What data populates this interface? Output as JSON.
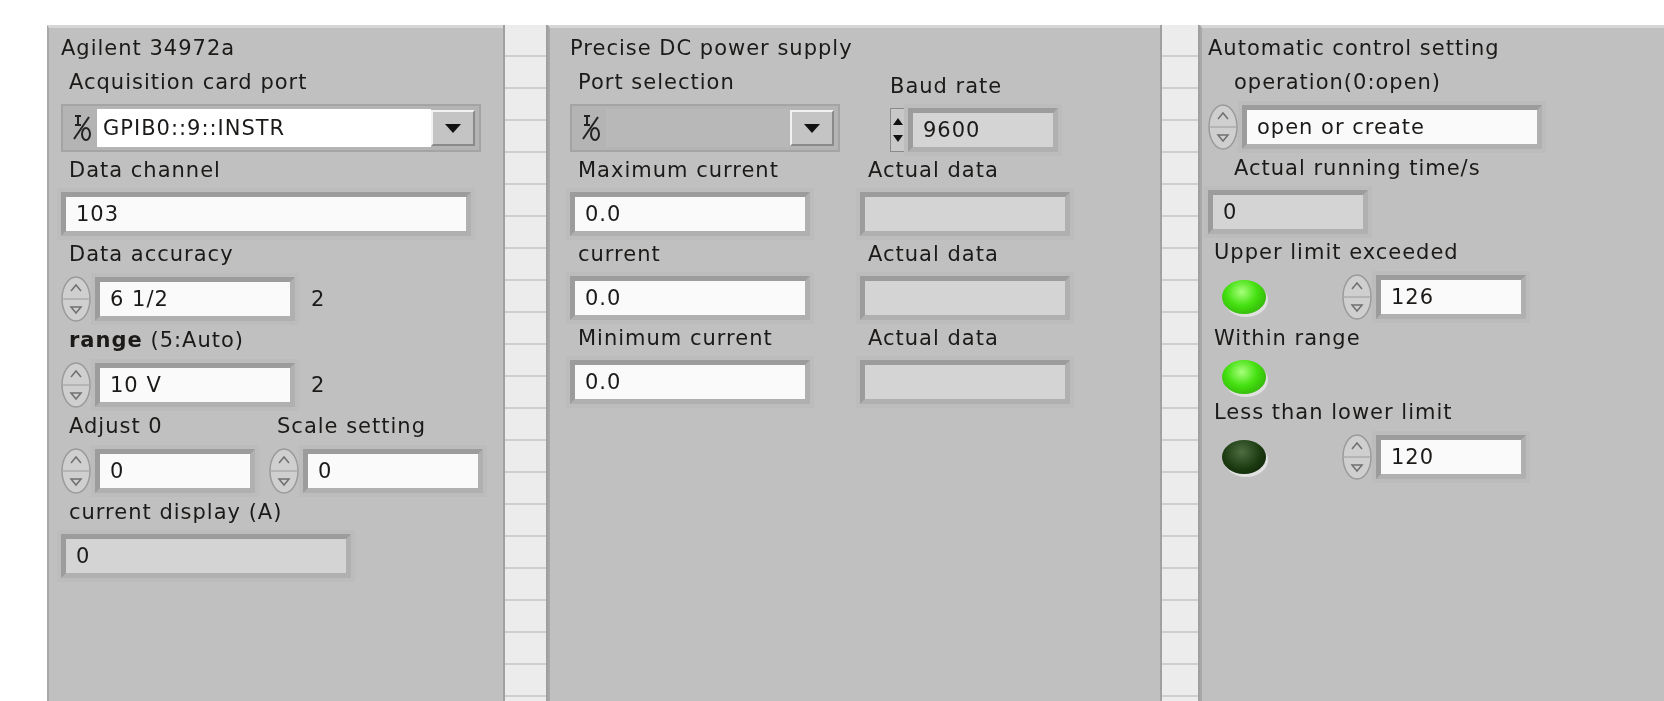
{
  "panels": [
    {
      "title": "Agilent 34972a",
      "controls": [
        {
          "kind": "ring",
          "label": "Acquisition card port",
          "value": "GPIB0::9::INSTR",
          "disabled": false
        },
        {
          "kind": "control",
          "label": "Data channel",
          "value": "103"
        },
        {
          "kind": "spin",
          "label": "Data accuracy",
          "value": "6 1/2",
          "note": "2"
        },
        {
          "kind": "spin",
          "label": "**range** (5:Auto)",
          "value": "10 V",
          "note": "2"
        },
        {
          "kind": "pair",
          "items": [
            {
              "kind": "spin",
              "label": "Adjust 0",
              "value": "0"
            },
            {
              "kind": "spin",
              "label": "Scale setting",
              "value": "0"
            }
          ]
        },
        {
          "kind": "indicator",
          "label": "current display  (A)",
          "value": "0"
        }
      ]
    },
    {
      "title": "Precise DC power supply",
      "controls": [
        {
          "kind": "pair",
          "items": [
            {
              "kind": "ring",
              "label": "Port selection",
              "disabled": true
            },
            {
              "kind": "updown",
              "label": "Baud rate",
              "value": "9600"
            }
          ]
        },
        {
          "kind": "pair",
          "items": [
            {
              "kind": "control",
              "label": "Maximum current",
              "value": "0.0"
            },
            {
              "kind": "indicator",
              "label": "Actual data"
            }
          ]
        },
        {
          "kind": "pair",
          "items": [
            {
              "kind": "control",
              "label": "current",
              "value": "0.0"
            },
            {
              "kind": "indicator",
              "label": "Actual data"
            }
          ]
        },
        {
          "kind": "pair",
          "items": [
            {
              "kind": "control",
              "label": "Minimum current",
              "value": "0.0"
            },
            {
              "kind": "indicator",
              "label": "Actual data"
            }
          ]
        }
      ]
    },
    {
      "title": "Automatic control setting",
      "controls": [
        {
          "kind": "spin",
          "label": "operation(0:open)",
          "value": "open or create"
        },
        {
          "kind": "indicator",
          "label": "Actual running time/s",
          "value": "0"
        },
        {
          "kind": "led",
          "label": "Upper limit exceeded",
          "on": true,
          "value": "126"
        },
        {
          "kind": "led",
          "label": "Within range",
          "on": true
        },
        {
          "kind": "led",
          "label": "Less than lower limit",
          "on": false,
          "value": "120"
        }
      ]
    }
  ]
}
